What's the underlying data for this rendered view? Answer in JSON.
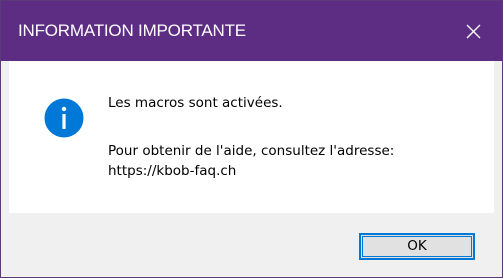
{
  "dialog": {
    "title": "INFORMATION IMPORTANTE",
    "close_icon": "close-icon",
    "icon": "info-icon",
    "message_line1": "Les macros sont activées.",
    "message_line2": "Pour obtenir de l'aide, consultez l'adresse:",
    "message_line3": "https://kbob-faq.ch",
    "ok_label": "OK"
  },
  "colors": {
    "titlebar": "#5c2d82",
    "info_icon": "#0078d7",
    "focus": "#0078d7"
  }
}
